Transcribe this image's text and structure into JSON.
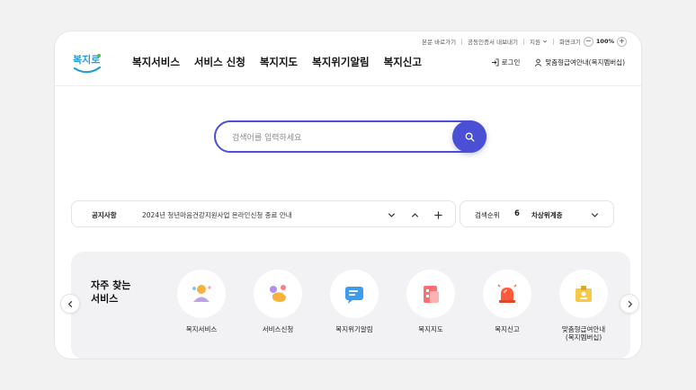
{
  "utility": {
    "skip": "본문 바로가기",
    "cert": "공동인증서 내보내기",
    "support": "지원",
    "zoom_label": "화면크기",
    "zoom_minus": "−",
    "zoom_value": "100%",
    "zoom_plus": "+"
  },
  "logo": {
    "text": "복지로"
  },
  "nav": {
    "items": [
      "복지서비스",
      "서비스 신청",
      "복지지도",
      "복지위기알림",
      "복지신고"
    ]
  },
  "header_links": {
    "login": "로그인",
    "membership": "맞춤형급여안내(복지멤버십)"
  },
  "search": {
    "placeholder": "검색어를 입력하세요"
  },
  "notice": {
    "label": "공지사항",
    "text": "2024년 청년마음건강지원사업 온라인신청 종료 안내"
  },
  "rank": {
    "label": "검색순위",
    "number": "6",
    "keyword": "차상위계층"
  },
  "favorites": {
    "title": "자주 찾는\n서비스",
    "items": [
      {
        "name": "복지서비스",
        "icon": "person-icon"
      },
      {
        "name": "서비스신청",
        "icon": "hand-icon"
      },
      {
        "name": "복지위기알림",
        "icon": "message-icon"
      },
      {
        "name": "복지지도",
        "icon": "map-icon"
      },
      {
        "name": "복지신고",
        "icon": "siren-icon"
      },
      {
        "name": "맞춤형급여안내\n(복지멤버십)",
        "icon": "badge-icon"
      }
    ]
  },
  "colors": {
    "accent": "#4b4fd6",
    "logo_blue": "#2a9bd8",
    "logo_green": "#52b84a"
  }
}
